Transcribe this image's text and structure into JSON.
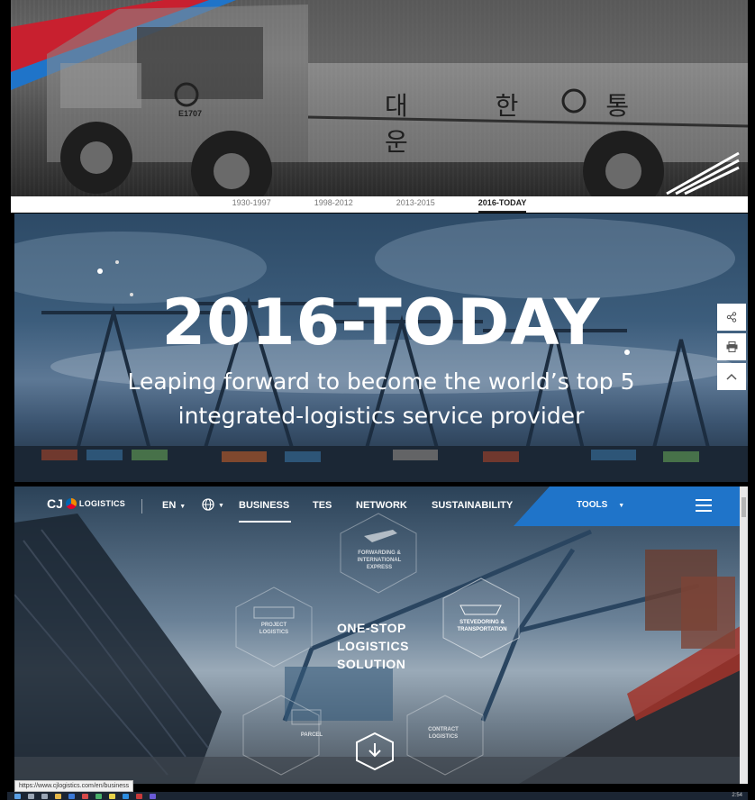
{
  "history": {
    "truck_text": "대 한 통 운",
    "truck_plate": "E1707",
    "timeline": [
      "1930-1997",
      "1998-2012",
      "2013-2015",
      "2016-TODAY"
    ]
  },
  "hero": {
    "title": "2016-TODAY",
    "subtitle_line1": "Leaping forward to become the world’s top 5",
    "subtitle_line2": "integrated-logistics service provider"
  },
  "side_tools": [
    "share-icon",
    "print-icon",
    "chevron-up-icon"
  ],
  "nav": {
    "logo_cj": "CJ",
    "logo_text": "LOGISTICS",
    "lang": "EN",
    "items": [
      "BUSINESS",
      "TES",
      "NETWORK",
      "SUSTAINABILITY"
    ],
    "tools": "TOOLS"
  },
  "hexes": {
    "forwarding": "FORWARDING & INTERNATIONAL EXPRESS",
    "project": "PROJECT LOGISTICS",
    "stevedoring": "STEVEDORING & TRANSPORTATION",
    "parcel": "PARCEL",
    "contract": "CONTRACT LOGISTICS"
  },
  "center": {
    "line1": "ONE-STOP",
    "line2": "LOGISTICS",
    "line3": "SOLUTION"
  },
  "status_url": "https://www.cjlogistics.com/en/business",
  "taskbar": {
    "time": "2:54"
  },
  "colors": {
    "accent_blue": "#1f74c9",
    "brand_red": "#c8202f"
  }
}
